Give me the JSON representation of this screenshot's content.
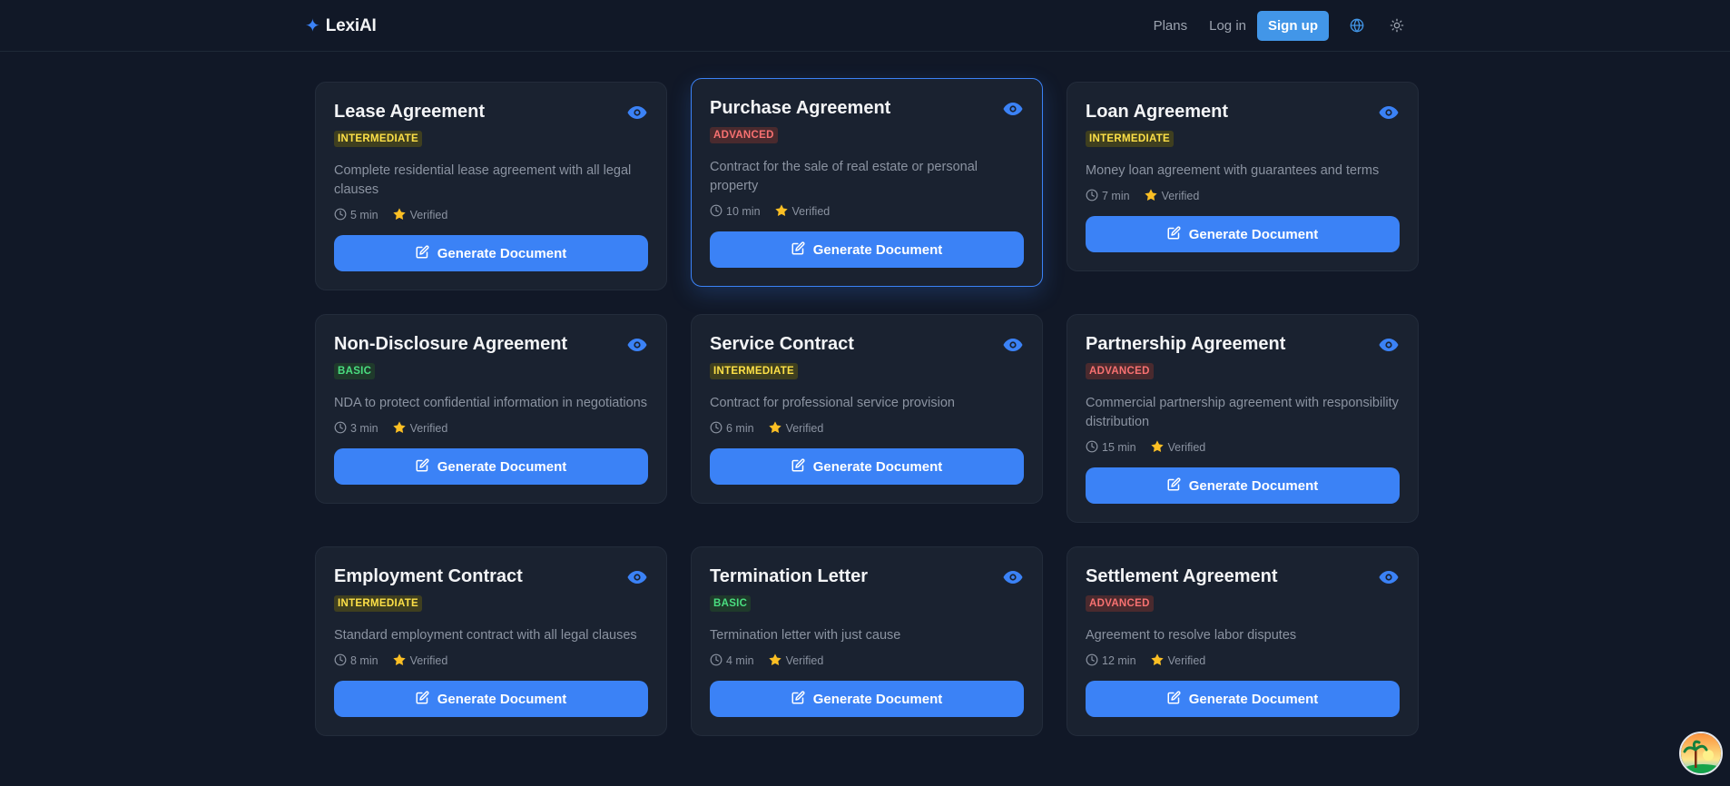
{
  "brand": {
    "name": "LexiAI",
    "icon": "sparkle-icon"
  },
  "nav": {
    "plans": "Plans",
    "login": "Log in",
    "signup": "Sign up",
    "globe_icon": "globe-icon",
    "theme_icon": "sun-icon"
  },
  "colors": {
    "background": "#111827",
    "card": "#1a2230",
    "accent": "#3b82f6",
    "intermediate": "#fde047",
    "advanced": "#f87171",
    "basic": "#4ade80",
    "star": "#fbbf24"
  },
  "verified_label": "Verified",
  "generate_label": "Generate Document",
  "cards": [
    {
      "title": "Lease Agreement",
      "level": "INTERMEDIATE",
      "level_class": "intermediate",
      "desc": "Complete residential lease agreement with all legal clauses",
      "time": "5 min",
      "highlight": false
    },
    {
      "title": "Purchase Agreement",
      "level": "ADVANCED",
      "level_class": "advanced",
      "desc": "Contract for the sale of real estate or personal property",
      "time": "10 min",
      "highlight": true
    },
    {
      "title": "Loan Agreement",
      "level": "INTERMEDIATE",
      "level_class": "intermediate",
      "desc": "Money loan agreement with guarantees and terms",
      "time": "7 min",
      "highlight": false
    },
    {
      "title": "Non-Disclosure Agreement",
      "level": "BASIC",
      "level_class": "basic",
      "desc": "NDA to protect confidential information in negotiations",
      "time": "3 min",
      "highlight": false
    },
    {
      "title": "Service Contract",
      "level": "INTERMEDIATE",
      "level_class": "intermediate",
      "desc": "Contract for professional service provision",
      "time": "6 min",
      "highlight": false
    },
    {
      "title": "Partnership Agreement",
      "level": "ADVANCED",
      "level_class": "advanced",
      "desc": "Commercial partnership agreement with responsibility distribution",
      "time": "15 min",
      "highlight": false
    },
    {
      "title": "Employment Contract",
      "level": "INTERMEDIATE",
      "level_class": "intermediate",
      "desc": "Standard employment contract with all legal clauses",
      "time": "8 min",
      "highlight": false
    },
    {
      "title": "Termination Letter",
      "level": "BASIC",
      "level_class": "basic",
      "desc": "Termination letter with just cause",
      "time": "4 min",
      "highlight": false
    },
    {
      "title": "Settlement Agreement",
      "level": "ADVANCED",
      "level_class": "advanced",
      "desc": "Agreement to resolve labor disputes",
      "time": "12 min",
      "highlight": false
    }
  ]
}
